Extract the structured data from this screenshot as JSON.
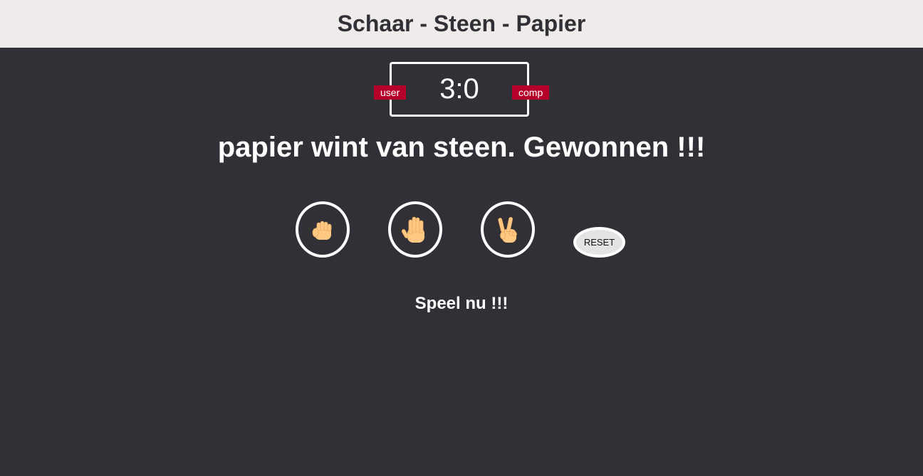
{
  "header": {
    "title": "Schaar - Steen - Papier"
  },
  "score": {
    "display": "3:0",
    "user": 3,
    "comp": 0,
    "user_label": "user",
    "comp_label": "comp"
  },
  "result_text": "papier wint van steen. Gewonnen !!!",
  "choices": [
    {
      "name": "rock",
      "icon": "fist-hand-icon"
    },
    {
      "name": "paper",
      "icon": "raised-hand-icon"
    },
    {
      "name": "scissors",
      "icon": "victory-hand-icon"
    }
  ],
  "reset_label": "RESET",
  "message": "Speel nu !!!",
  "colors": {
    "header_bg": "#eeebea",
    "page_bg": "#313036",
    "badge_bg": "#b5002a",
    "skin": "#ffc983"
  }
}
